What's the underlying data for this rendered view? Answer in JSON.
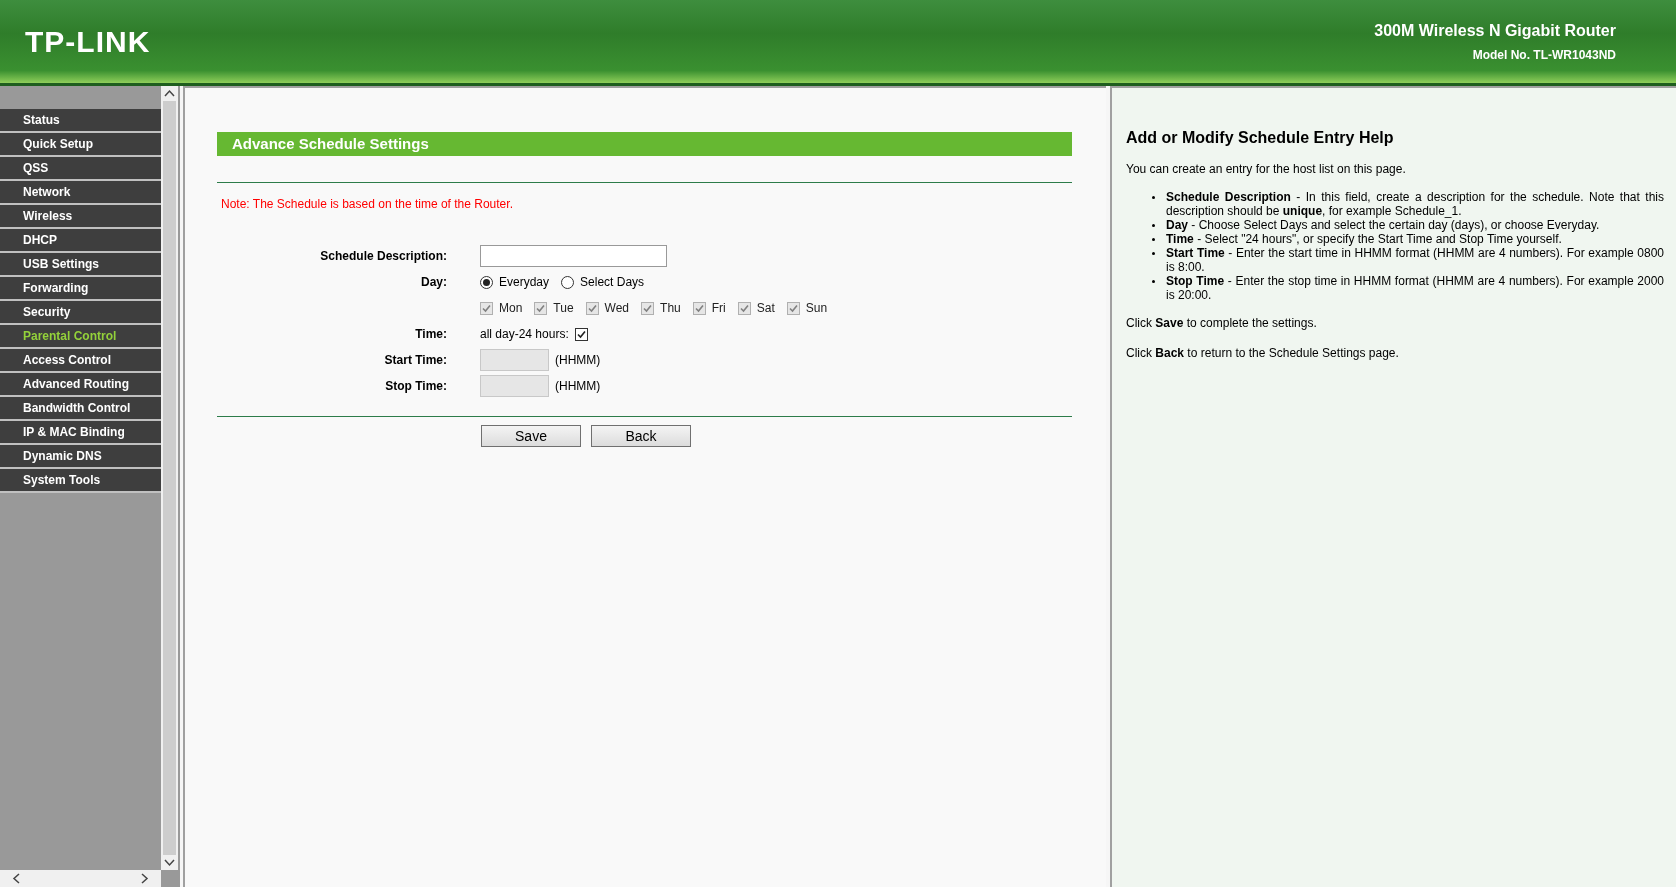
{
  "header": {
    "logo": "TP-LINK",
    "product": "300M Wireless N Gigabit Router",
    "model": "Model No. TL-WR1043ND"
  },
  "sidebar": {
    "items": [
      {
        "label": "Status",
        "selected": false
      },
      {
        "label": "Quick Setup",
        "selected": false
      },
      {
        "label": "QSS",
        "selected": false
      },
      {
        "label": "Network",
        "selected": false
      },
      {
        "label": "Wireless",
        "selected": false
      },
      {
        "label": "DHCP",
        "selected": false
      },
      {
        "label": "USB Settings",
        "selected": false
      },
      {
        "label": "Forwarding",
        "selected": false
      },
      {
        "label": "Security",
        "selected": false
      },
      {
        "label": "Parental Control",
        "selected": true
      },
      {
        "label": "Access Control",
        "selected": false
      },
      {
        "label": "Advanced Routing",
        "selected": false
      },
      {
        "label": "Bandwidth Control",
        "selected": false
      },
      {
        "label": "IP & MAC Binding",
        "selected": false
      },
      {
        "label": "Dynamic DNS",
        "selected": false
      },
      {
        "label": "System Tools",
        "selected": false
      }
    ]
  },
  "form": {
    "title": "Advance Schedule Settings",
    "note": "Note: The Schedule is based on the time of the Router.",
    "description": {
      "label": "Schedule Description:"
    },
    "day": {
      "label": "Day:",
      "options": [
        {
          "label": "Everyday",
          "selected": true
        },
        {
          "label": "Select Days",
          "selected": false
        }
      ],
      "days": [
        {
          "label": "Mon",
          "checked": true,
          "disabled": true
        },
        {
          "label": "Tue",
          "checked": true,
          "disabled": true
        },
        {
          "label": "Wed",
          "checked": true,
          "disabled": true
        },
        {
          "label": "Thu",
          "checked": true,
          "disabled": true
        },
        {
          "label": "Fri",
          "checked": true,
          "disabled": true
        },
        {
          "label": "Sat",
          "checked": true,
          "disabled": true
        },
        {
          "label": "Sun",
          "checked": true,
          "disabled": true
        }
      ]
    },
    "time": {
      "label": "Time:",
      "allday_label": "all day-24 hours:",
      "checked": true
    },
    "start_time": {
      "label": "Start Time:",
      "hint": "(HHMM)",
      "disabled": true
    },
    "stop_time": {
      "label": "Stop Time:",
      "hint": "(HHMM)",
      "disabled": true
    },
    "buttons": [
      "Save",
      "Back"
    ]
  },
  "help": {
    "title": "Add or Modify Schedule Entry Help",
    "intro": "You can create an entry for the host list on this page.",
    "items": [
      "**Schedule Description** - In this field, create a description for the schedule. Note that this description should be **unique**, for example Schedule_1.",
      "**Day** - Choose Select Days and select the certain day (days), or choose Everyday.",
      "**Time** - Select \"24 hours\", or specify the Start Time and Stop Time yourself.",
      "**Start Time** - Enter the start time in HHMM format (HHMM are 4 numbers). For example 0800 is 8:00.",
      "**Stop Time** - Enter the stop time in HHMM format (HHMM are 4 numbers). For example 2000 is 20:00."
    ],
    "footer": [
      "Click **Save** to complete the settings.",
      "Click **Back** to return to the Schedule Settings page."
    ]
  }
}
